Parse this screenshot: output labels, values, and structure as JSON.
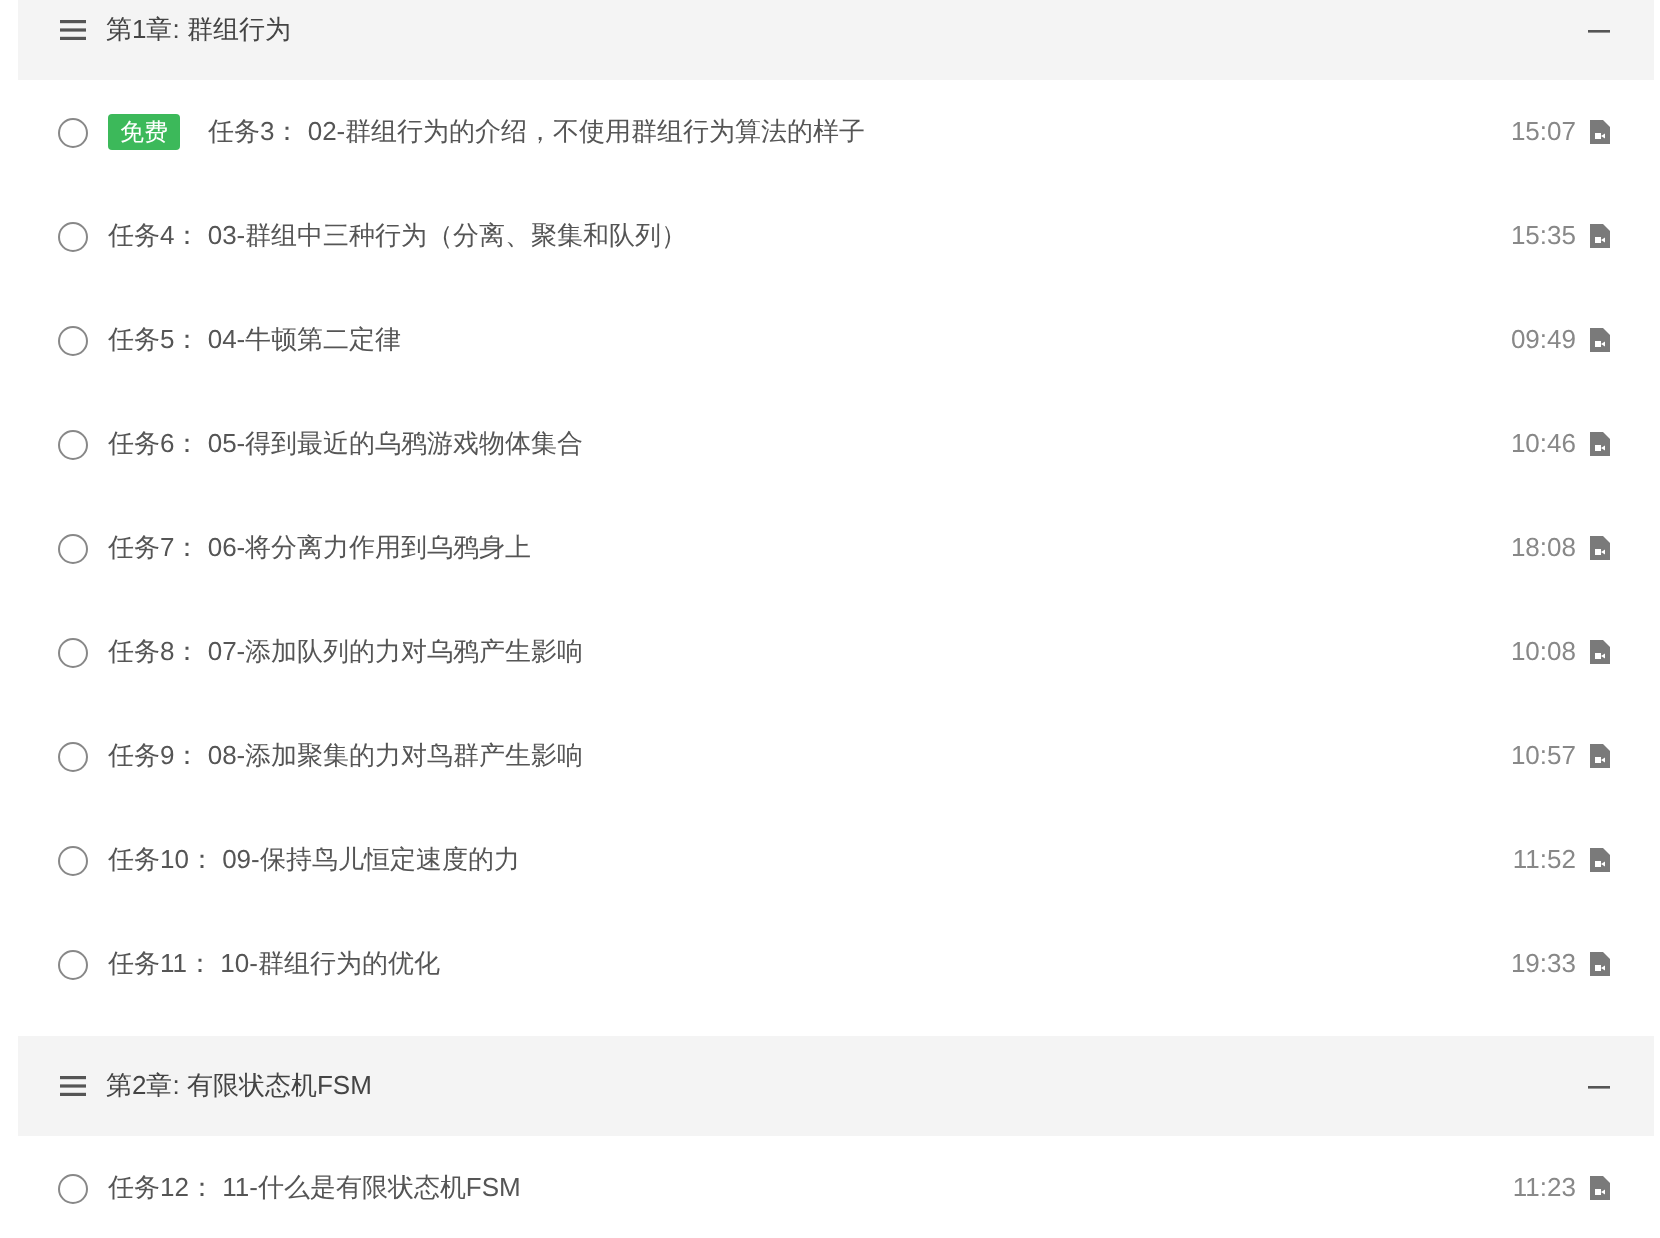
{
  "chapters": [
    {
      "title": "第1章: 群组行为",
      "expanded": true,
      "lessons": [
        {
          "badge": "免费",
          "title": "任务3： 02-群组行为的介绍，不使用群组行为算法的样子",
          "duration": "15:07"
        },
        {
          "title": "任务4： 03-群组中三种行为（分离、聚集和队列）",
          "duration": "15:35"
        },
        {
          "title": "任务5： 04-牛顿第二定律",
          "duration": "09:49"
        },
        {
          "title": "任务6： 05-得到最近的乌鸦游戏物体集合",
          "duration": "10:46"
        },
        {
          "title": "任务7： 06-将分离力作用到乌鸦身上",
          "duration": "18:08"
        },
        {
          "title": "任务8： 07-添加队列的力对乌鸦产生影响",
          "duration": "10:08"
        },
        {
          "title": "任务9： 08-添加聚集的力对鸟群产生影响",
          "duration": "10:57"
        },
        {
          "title": "任务10： 09-保持鸟儿恒定速度的力",
          "duration": "11:52"
        },
        {
          "title": "任务11： 10-群组行为的优化",
          "duration": "19:33"
        }
      ]
    },
    {
      "title": "第2章: 有限状态机FSM",
      "expanded": true,
      "lessons": [
        {
          "title": "任务12： 11-什么是有限状态机FSM",
          "duration": "11:23"
        }
      ]
    }
  ]
}
